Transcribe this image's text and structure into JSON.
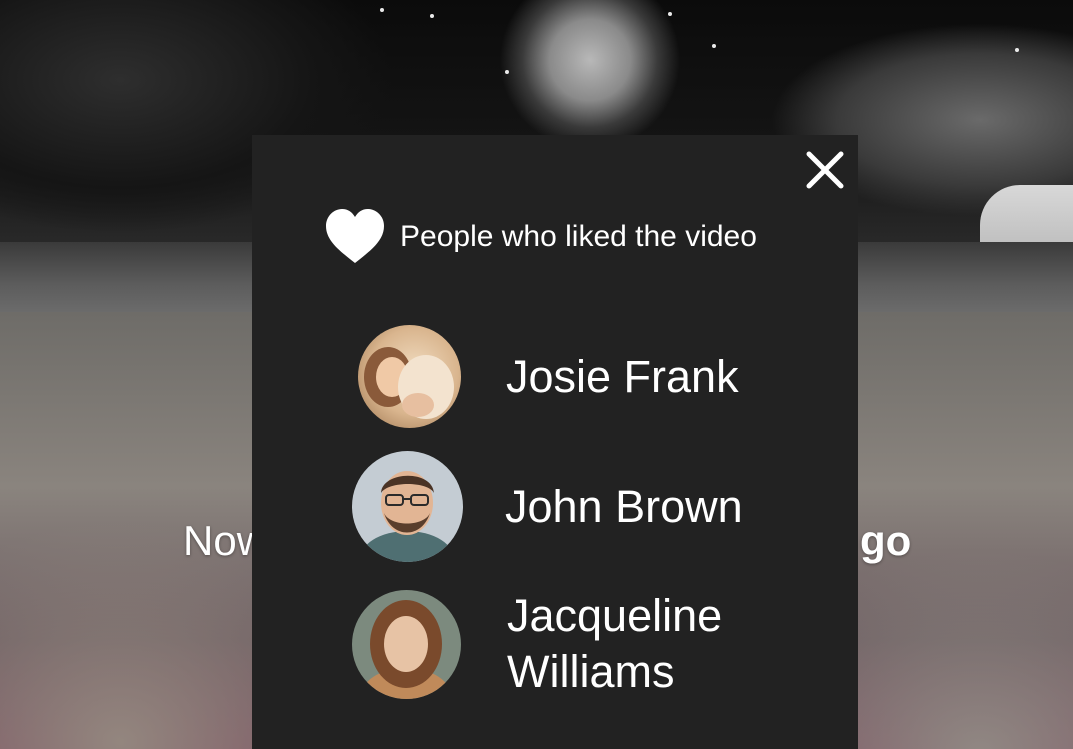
{
  "background": {
    "caption_left": "Now",
    "caption_right": "e go"
  },
  "modal": {
    "title": "People who liked the video",
    "close_icon": "close-icon",
    "heart_icon": "heart-icon",
    "colors": {
      "panel": "#222222",
      "text": "#ffffff"
    }
  },
  "people": [
    {
      "name": "Josie Frank",
      "avatar_icon": "avatar-photo",
      "avatar_tint": "#c9a27c"
    },
    {
      "name": "John Brown",
      "avatar_icon": "avatar-photo",
      "avatar_tint": "#b9c3cb"
    },
    {
      "name": "Jacqueline Williams",
      "avatar_icon": "avatar-photo",
      "avatar_tint": "#9b6a4a"
    }
  ]
}
